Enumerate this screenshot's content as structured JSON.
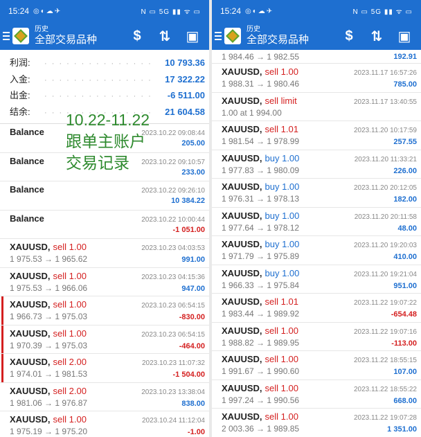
{
  "status": {
    "time": "15:24",
    "left_icons": "◎◐☁✈",
    "right_icons": "N ▭ 5G ▮▮ ᯤ ▭"
  },
  "header": {
    "small_title": "历史",
    "large_title": "全部交易品种",
    "icons": [
      "money-sort-icon",
      "sort-arrows-icon",
      "calendar-icon"
    ]
  },
  "summary": [
    {
      "label": "利润:",
      "value": "10 793.36"
    },
    {
      "label": "入金:",
      "value": "17 322.22"
    },
    {
      "label": "出金:",
      "value": "-6 511.00"
    },
    {
      "label": "结余:",
      "value": "21 604.58"
    }
  ],
  "overlay_text": [
    "10.22-11.22",
    "跟单主账户",
    "交易记录"
  ],
  "left_deals": [
    {
      "symbol": "Balance",
      "side": "",
      "prices": "",
      "time": "2023.10.22 09:08:44",
      "profit": "205.00",
      "sign": "pos",
      "mark": false
    },
    {
      "symbol": "Balance",
      "side": "",
      "prices": "",
      "time": "2023.10.22 09:10:57",
      "profit": "233.00",
      "sign": "pos",
      "mark": false
    },
    {
      "symbol": "Balance",
      "side": "",
      "prices": "",
      "time": "2023.10.22 09:26:10",
      "profit": "10 384.22",
      "sign": "pos",
      "mark": false
    },
    {
      "symbol": "Balance",
      "side": "",
      "prices": "",
      "time": "2023.10.22 10:00:44",
      "profit": "-1 051.00",
      "sign": "neg",
      "mark": false
    },
    {
      "symbol": "XAUUSD,",
      "side": "sell 1.00",
      "prices": "1 975.53 → 1 965.62",
      "time": "2023.10.23 04:03:53",
      "profit": "991.00",
      "sign": "pos",
      "mark": false
    },
    {
      "symbol": "XAUUSD,",
      "side": "sell 1.00",
      "prices": "1 975.53 → 1 966.06",
      "time": "2023.10.23 04:15:36",
      "profit": "947.00",
      "sign": "pos",
      "mark": false
    },
    {
      "symbol": "XAUUSD,",
      "side": "sell 1.00",
      "prices": "1 966.73 → 1 975.03",
      "time": "2023.10.23 06:54:15",
      "profit": "-830.00",
      "sign": "neg",
      "mark": true
    },
    {
      "symbol": "XAUUSD,",
      "side": "sell 1.00",
      "prices": "1 970.39 → 1 975.03",
      "time": "2023.10.23 06:54:15",
      "profit": "-464.00",
      "sign": "neg",
      "mark": true
    },
    {
      "symbol": "XAUUSD,",
      "side": "sell 2.00",
      "prices": "1 974.01 → 1 981.53",
      "time": "2023.10.23 11:07:32",
      "profit": "-1 504.00",
      "sign": "neg",
      "mark": true
    },
    {
      "symbol": "XAUUSD,",
      "side": "sell 2.00",
      "prices": "1 981.06 → 1 976.87",
      "time": "2023.10.23 13:38:04",
      "profit": "838.00",
      "sign": "pos",
      "mark": false
    },
    {
      "symbol": "XAUUSD,",
      "side": "sell 1.00",
      "prices": "1 975.19 → 1 975.20",
      "time": "2023.10.24 11:12:04",
      "profit": "-1.00",
      "sign": "neg",
      "mark": false
    }
  ],
  "right_partial": {
    "prices": "1 984.46 → 1 982.55",
    "profit": "192.91"
  },
  "right_deals": [
    {
      "symbol": "XAUUSD,",
      "side": "sell 1.00",
      "prices": "1 988.31 → 1 980.46",
      "time": "2023.11.17 16:57:26",
      "profit": "785.00",
      "sign": "pos",
      "buy": false
    },
    {
      "symbol": "XAUUSD,",
      "side": "sell limit",
      "prices": "1.00 at 1 994.00",
      "time": "2023.11.17 13:40:55",
      "profit": "",
      "sign": "pos",
      "buy": false
    },
    {
      "symbol": "XAUUSD,",
      "side": "sell 1.01",
      "prices": "1 981.54 → 1 978.99",
      "time": "2023.11.20 10:17:59",
      "profit": "257.55",
      "sign": "pos",
      "buy": false
    },
    {
      "symbol": "XAUUSD,",
      "side": "buy 1.00",
      "prices": "1 977.83 → 1 980.09",
      "time": "2023.11.20 11:33:21",
      "profit": "226.00",
      "sign": "pos",
      "buy": true
    },
    {
      "symbol": "XAUUSD,",
      "side": "buy 1.00",
      "prices": "1 976.31 → 1 978.13",
      "time": "2023.11.20 20:12:05",
      "profit": "182.00",
      "sign": "pos",
      "buy": true
    },
    {
      "symbol": "XAUUSD,",
      "side": "buy 1.00",
      "prices": "1 977.64 → 1 978.12",
      "time": "2023.11.20 20:11:58",
      "profit": "48.00",
      "sign": "pos",
      "buy": true
    },
    {
      "symbol": "XAUUSD,",
      "side": "buy 1.00",
      "prices": "1 971.79 → 1 975.89",
      "time": "2023.11.20 19:20:03",
      "profit": "410.00",
      "sign": "pos",
      "buy": true
    },
    {
      "symbol": "XAUUSD,",
      "side": "buy 1.00",
      "prices": "1 966.33 → 1 975.84",
      "time": "2023.11.20 19:21:04",
      "profit": "951.00",
      "sign": "pos",
      "buy": true
    },
    {
      "symbol": "XAUUSD,",
      "side": "sell 1.01",
      "prices": "1 983.44 → 1 989.92",
      "time": "2023.11.22 19:07:22",
      "profit": "-654.48",
      "sign": "neg",
      "buy": false
    },
    {
      "symbol": "XAUUSD,",
      "side": "sell 1.00",
      "prices": "1 988.82 → 1 989.95",
      "time": "2023.11.22 19:07:16",
      "profit": "-113.00",
      "sign": "neg",
      "buy": false
    },
    {
      "symbol": "XAUUSD,",
      "side": "sell 1.00",
      "prices": "1 991.67 → 1 990.60",
      "time": "2023.11.22 18:55:15",
      "profit": "107.00",
      "sign": "pos",
      "buy": false
    },
    {
      "symbol": "XAUUSD,",
      "side": "sell 1.00",
      "prices": "1 997.24 → 1 990.56",
      "time": "2023.11.22 18:55:22",
      "profit": "668.00",
      "sign": "pos",
      "buy": false
    },
    {
      "symbol": "XAUUSD,",
      "side": "sell 1.00",
      "prices": "2 003.36 → 1 989.85",
      "time": "2023.11.22 19:07:28",
      "profit": "1 351.00",
      "sign": "pos",
      "buy": false
    }
  ]
}
